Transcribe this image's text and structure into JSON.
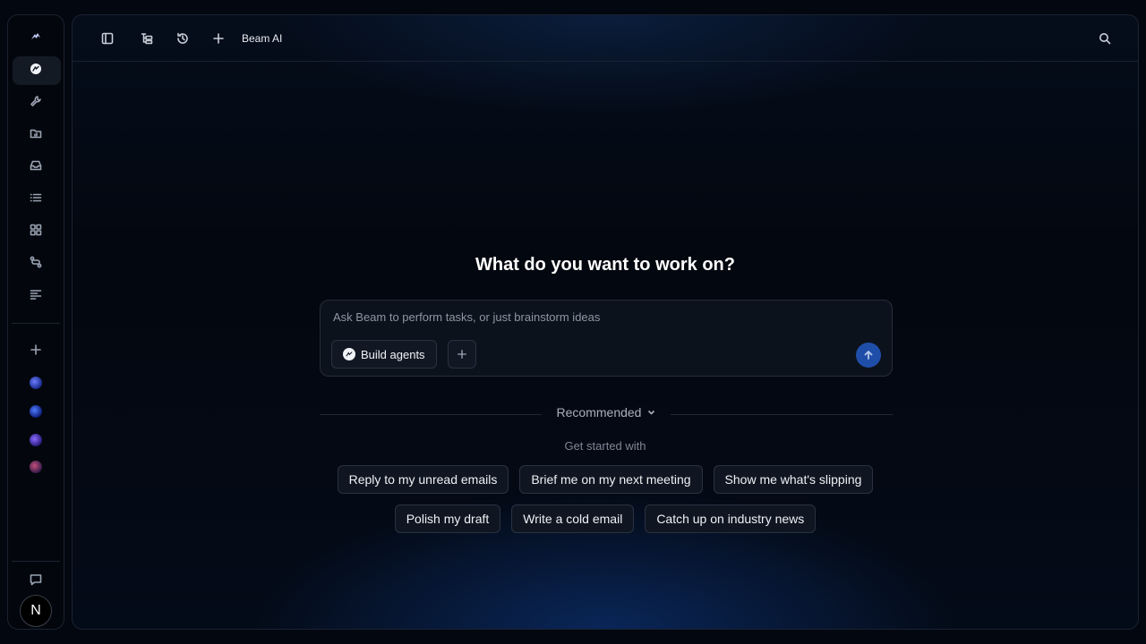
{
  "topbar": {
    "title": "Beam AI",
    "icons": [
      "sidebar-toggle-icon",
      "tree-structure-icon",
      "history-icon",
      "plus-icon",
      "search-icon"
    ]
  },
  "rail": {
    "icons": [
      "beam-logo-icon",
      "beam-agent-icon",
      "wrench-icon",
      "folder-icon",
      "inbox-icon",
      "list-icon",
      "grid-icon",
      "git-compare-icon",
      "align-left-icon",
      "plus-icon",
      "chat-icon"
    ],
    "avatar_letter": "N"
  },
  "main": {
    "headline": "What do you want to work on?",
    "composer": {
      "placeholder": "Ask Beam to perform tasks, or just brainstorm ideas",
      "value": "",
      "build_label": "Build agents"
    },
    "recommended_label": "Recommended",
    "get_started_label": "Get started with",
    "suggestions_row1": [
      "Reply to my unread emails",
      "Brief me on my next meeting",
      "Show me what's slipping"
    ],
    "suggestions_row2": [
      "Polish my draft",
      "Write a cold email",
      "Catch up on industry news"
    ]
  },
  "colors": {
    "accent": "#1f4ea8",
    "background": "#020710"
  }
}
